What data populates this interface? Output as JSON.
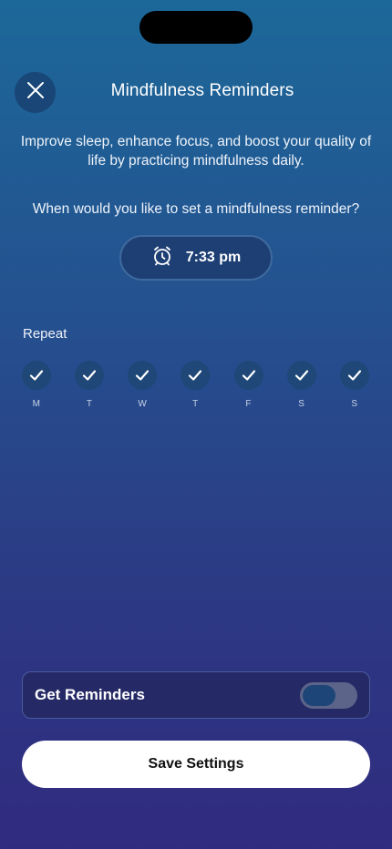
{
  "header": {
    "title": "Mindfulness Reminders",
    "close_icon": "close-icon"
  },
  "intro": {
    "subtitle": "Improve sleep, enhance focus, and boost your quality of life by practicing mindfulness daily.",
    "question": "When would you like to set a mindfulness reminder?"
  },
  "time_picker": {
    "icon": "alarm-clock-icon",
    "value": "7:33 pm"
  },
  "repeat": {
    "label": "Repeat",
    "days": [
      {
        "letter": "M",
        "checked": true
      },
      {
        "letter": "T",
        "checked": true
      },
      {
        "letter": "W",
        "checked": true
      },
      {
        "letter": "T",
        "checked": true
      },
      {
        "letter": "F",
        "checked": true
      },
      {
        "letter": "S",
        "checked": true
      },
      {
        "letter": "S",
        "checked": true
      }
    ]
  },
  "reminders": {
    "label": "Get Reminders",
    "enabled": false
  },
  "footer": {
    "save_label": "Save Settings"
  },
  "colors": {
    "background_top": "#1c6899",
    "background_bottom": "#302b7f",
    "button_bg": "#ffffff",
    "toggle_track": "#5c6489"
  }
}
